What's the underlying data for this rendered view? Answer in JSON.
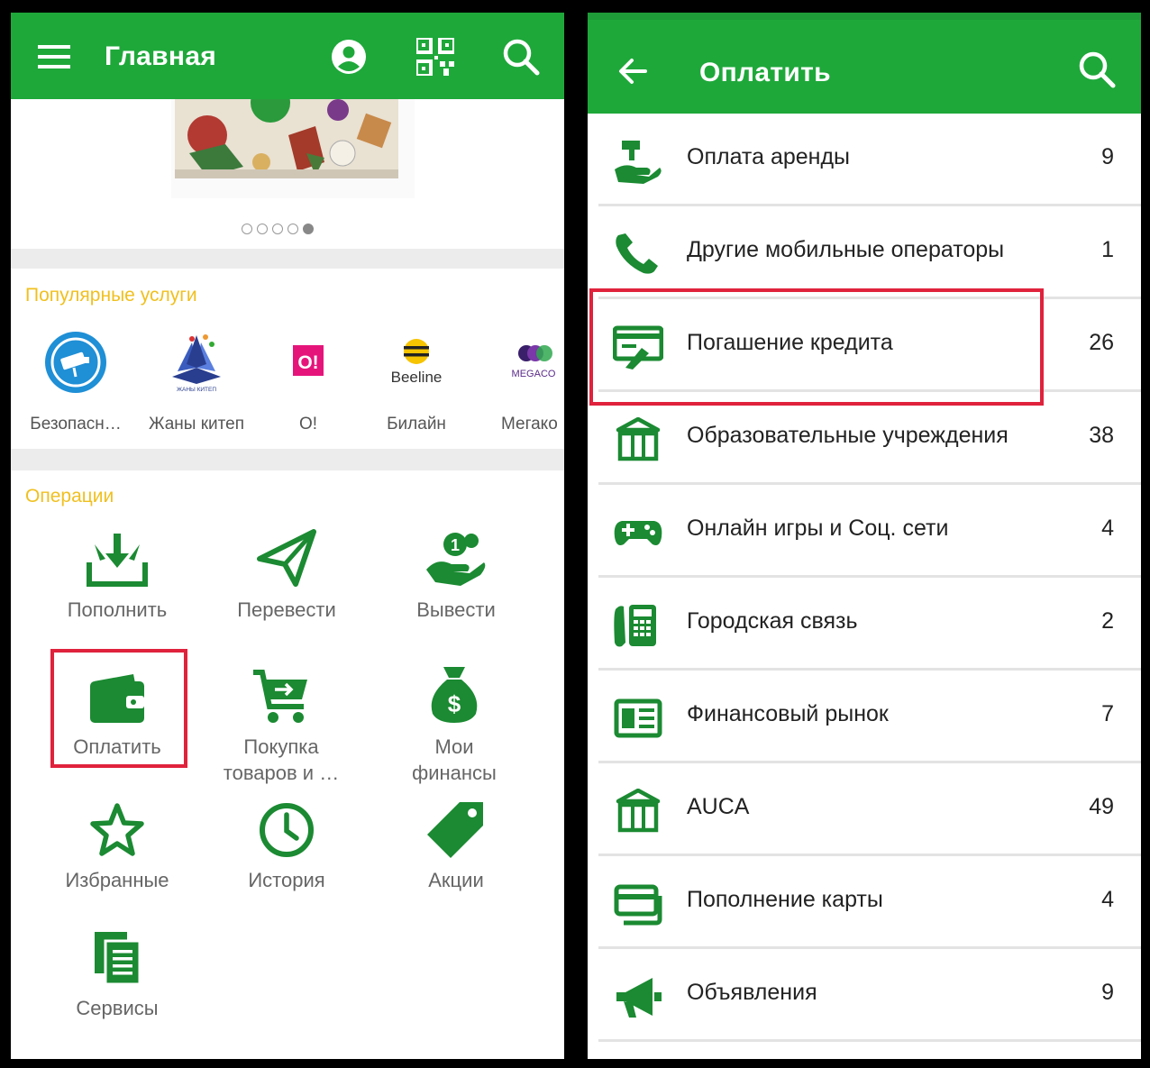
{
  "left": {
    "title": "Главная",
    "popular_title": "Популярные услуги",
    "popular": [
      {
        "label": "Безопасн…",
        "icon": "camera-shield-icon"
      },
      {
        "label": "Жаны китеп",
        "icon": "book-logo-icon",
        "logo_text": "ЖАНЫ КИТЕП"
      },
      {
        "label": "O!",
        "icon": "o-logo-icon",
        "logo_text": "O!"
      },
      {
        "label": "Билайн",
        "icon": "beeline-logo-icon",
        "logo_text": "Beeline"
      },
      {
        "label": "Мегако",
        "icon": "megacom-logo-icon",
        "logo_text": "MEGACO"
      }
    ],
    "operations_title": "Операции",
    "operations": [
      {
        "label": "Пополнить",
        "icon": "deposit-icon"
      },
      {
        "label": "Перевести",
        "icon": "send-plane-icon"
      },
      {
        "label": "Вывести",
        "icon": "withdraw-hand-icon"
      },
      {
        "label": "Оплатить",
        "icon": "wallet-icon"
      },
      {
        "label": "Покупка\nтоваров и …",
        "icon": "cart-icon"
      },
      {
        "label": "Мои\nфинансы",
        "icon": "money-bag-icon"
      },
      {
        "label": "Избранные",
        "icon": "star-icon"
      },
      {
        "label": "История",
        "icon": "clock-icon"
      },
      {
        "label": "Акции",
        "icon": "tag-icon"
      },
      {
        "label": "Сервисы",
        "icon": "documents-icon"
      }
    ],
    "banner_dots": {
      "count": 5,
      "active": 5
    }
  },
  "right": {
    "title": "Оплатить",
    "items": [
      {
        "label": "Оплата аренды",
        "count": "9",
        "icon": "rent-hand-icon"
      },
      {
        "label": "Другие мобильные операторы",
        "count": "1",
        "icon": "phone-icon"
      },
      {
        "label": "Погашение кредита",
        "count": "26",
        "icon": "credit-payment-icon"
      },
      {
        "label": "Образовательные учреждения",
        "count": "38",
        "icon": "institution-icon"
      },
      {
        "label": "Онлайн игры и Соц. сети",
        "count": "4",
        "icon": "gamepad-icon"
      },
      {
        "label": "Городская связь",
        "count": "2",
        "icon": "landline-icon"
      },
      {
        "label": "Финансовый рынок",
        "count": "7",
        "icon": "finance-card-icon"
      },
      {
        "label": "AUCA",
        "count": "49",
        "icon": "institution-icon"
      },
      {
        "label": "Пополнение карты",
        "count": "4",
        "icon": "cards-icon"
      },
      {
        "label": "Объявления",
        "count": "9",
        "icon": "megaphone-icon"
      }
    ]
  },
  "colors": {
    "brand_green": "#1ea83a",
    "accent_yellow": "#f0c020",
    "highlight_red": "#e0223c"
  }
}
